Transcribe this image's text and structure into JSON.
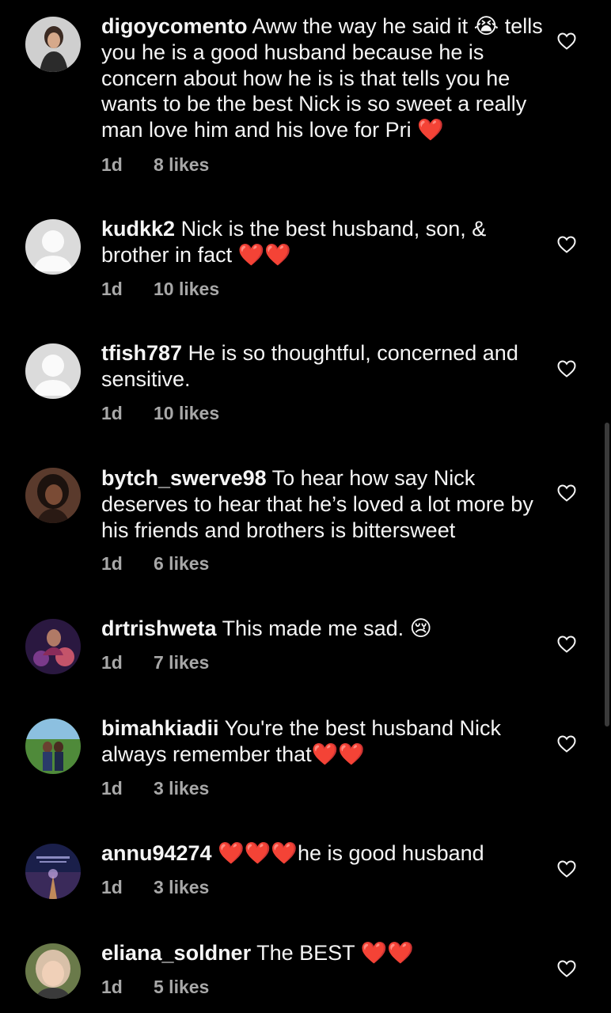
{
  "comments": [
    {
      "username": "digoycomento",
      "text": "Aww the way he said it 😭 tells you he is a  good husband because he is concern about how he is is that tells you he wants to be the best Nick is so sweet a really man love him and his love for Pri ❤️",
      "time": "1d",
      "likes": "8 likes",
      "avatar": "photo-woman"
    },
    {
      "username": "kudkk2",
      "text": "Nick is the best husband, son, & brother in fact ❤️❤️",
      "time": "1d",
      "likes": "10 likes",
      "avatar": "default-silhouette"
    },
    {
      "username": "tfish787",
      "text": "He is so thoughtful,  concerned and sensitive.",
      "time": "1d",
      "likes": "10 likes",
      "avatar": "default-silhouette"
    },
    {
      "username": "bytch_swerve98",
      "text": "To hear how say Nick deserves to hear that he’s loved a lot more by his friends and brothers is bittersweet",
      "time": "1d",
      "likes": "6 likes",
      "avatar": "photo-woman-dark"
    },
    {
      "username": "drtrishweta",
      "text": "This made me sad. 😢",
      "time": "1d",
      "likes": "7 likes",
      "avatar": "photo-purple"
    },
    {
      "username": "bimahkiadii",
      "text": "You're the best husband Nick always remember that❤️❤️",
      "time": "1d",
      "likes": "3 likes",
      "avatar": "photo-couple-green"
    },
    {
      "username": "annu94274",
      "text": "❤️❤️❤️he is good husband",
      "time": "1d",
      "likes": "3 likes",
      "avatar": "photo-road-sky"
    },
    {
      "username": "eliana_soldner",
      "text": "The BEST ❤️❤️",
      "time": "1d",
      "likes": "5 likes",
      "avatar": "photo-woman-light"
    }
  ],
  "colors": {
    "background": "#000000",
    "text": "#f5f5f5",
    "meta": "#a8a8a8",
    "scrollbar": "#3a3a3a"
  }
}
